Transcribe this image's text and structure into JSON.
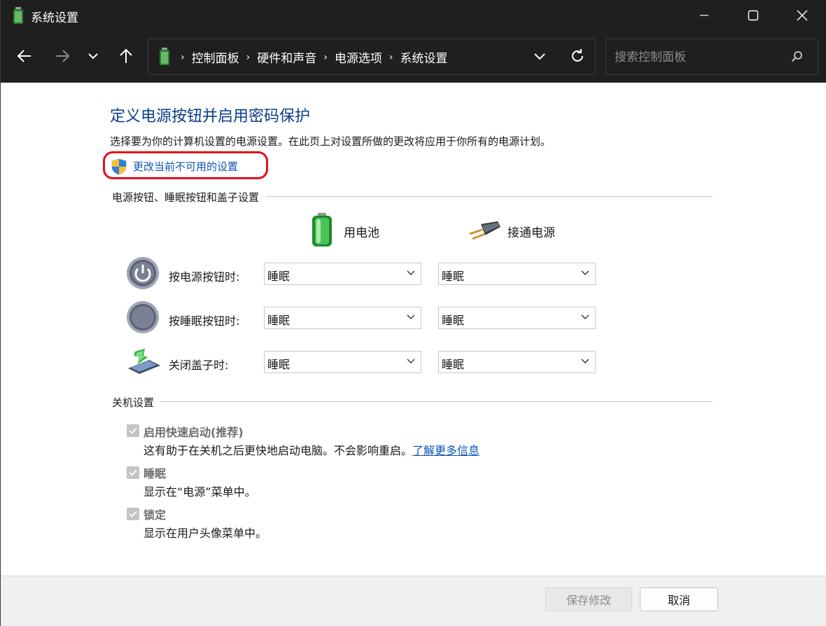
{
  "window": {
    "title": "系统设置"
  },
  "breadcrumbs": [
    "控制面板",
    "硬件和声音",
    "电源选项",
    "系统设置"
  ],
  "search": {
    "placeholder": "搜索控制面板"
  },
  "main": {
    "heading": "定义电源按钮并启用密码保护",
    "description": "选择要为你的计算机设置的电源设置。在此页上对设置所做的更改将应用于你所有的电源计划。",
    "change_link": "更改当前不可用的设置",
    "buttons_section": {
      "title": "电源按钮、睡眠按钮和盖子设置",
      "col_battery": "用电池",
      "col_plugged": "接通电源",
      "rows": [
        {
          "label": "按电源按钮时:",
          "battery": "睡眠",
          "plugged": "睡眠"
        },
        {
          "label": "按睡眠按钮时:",
          "battery": "睡眠",
          "plugged": "睡眠"
        },
        {
          "label": "关闭盖子时:",
          "battery": "睡眠",
          "plugged": "睡眠"
        }
      ]
    },
    "shutdown_section": {
      "title": "关机设置",
      "items": [
        {
          "label": "启用快速启动(推荐)",
          "desc": "这有助于在关机之后更快地启动电脑。不会影响重启。",
          "link": "了解更多信息",
          "checked": true
        },
        {
          "label": "睡眠",
          "desc": "显示在“电源”菜单中。",
          "checked": true
        },
        {
          "label": "锁定",
          "desc": "显示在用户头像菜单中。",
          "checked": true
        }
      ]
    }
  },
  "footer": {
    "save_label": "保存修改",
    "cancel_label": "取消"
  },
  "colors": {
    "titlebar": "#1f1f1f",
    "heading": "#0a3d8a",
    "link": "#0b55b8",
    "highlight": "#e0111b"
  }
}
